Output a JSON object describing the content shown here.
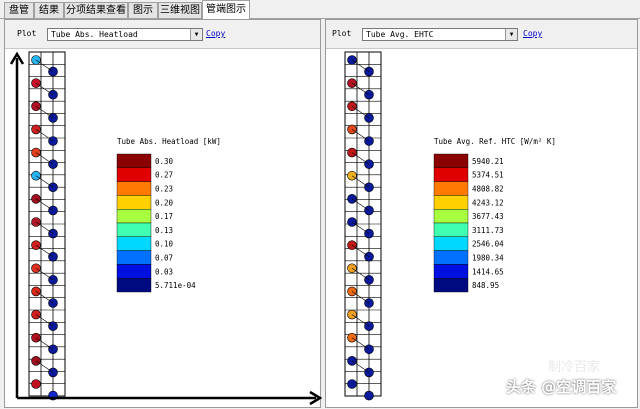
{
  "tabs": [
    "盘管",
    "结果",
    "分项结果查看",
    "图示",
    "三维视图",
    "管端图示"
  ],
  "active_tab": 5,
  "left": {
    "plot_label": "Plot",
    "select_value": "Tube Abs. Heatload",
    "copy_label": "Copy",
    "legend_title": "Tube Abs. Heatload [kW]",
    "legend_values": [
      "0.30",
      "0.27",
      "0.23",
      "0.20",
      "0.17",
      "0.13",
      "0.10",
      "0.07",
      "0.03",
      "5.711e-04"
    ],
    "tube_colors_col1": [
      "#28b4f0",
      "#c8102a",
      "#b31028",
      "#d02020",
      "#e04020",
      "#28b4f0",
      "#a01020",
      "#b01828",
      "#d02020",
      "#e03020",
      "#d82818",
      "#d02020",
      "#b01020",
      "#a01020",
      "#c01020"
    ],
    "tube_colors_col2": [
      "#0a1a9a",
      "#0a1a9a",
      "#0a1a9a",
      "#0a1a9a",
      "#0a1a9a",
      "#0a1a9a",
      "#0a1a9a",
      "#0a1a9a",
      "#0a1a9a",
      "#0a1a9a",
      "#0a1a9a",
      "#0a1a9a",
      "#0a1a9a",
      "#0a1a9a",
      "#1428d0"
    ]
  },
  "right": {
    "plot_label": "Plot",
    "select_value": "Tube Avg. EHTC",
    "copy_label": "Copy",
    "legend_title": "Tube Avg. Ref. HTC [W/m² K]",
    "legend_values": [
      "5940.21",
      "5374.51",
      "4808.82",
      "4243.12",
      "3677.43",
      "3111.73",
      "2546.04",
      "1980.34",
      "1414.65",
      "848.95"
    ],
    "tube_colors_col1": [
      "#0a1a9a",
      "#b01020",
      "#c01818",
      "#e04818",
      "#c01818",
      "#f0b020",
      "#0a1a9a",
      "#0a1a9a",
      "#c01818",
      "#f0a020",
      "#f06a10",
      "#f0a020",
      "#f06a10",
      "#0a1a9a",
      "#0a1a9a"
    ],
    "tube_colors_col2": [
      "#0a1a9a",
      "#0a1a9a",
      "#0a1a9a",
      "#0a1a9a",
      "#0a1a9a",
      "#0a1a9a",
      "#0a1a9a",
      "#0a1a9a",
      "#0a1a9a",
      "#0a1a9a",
      "#0a1a9a",
      "#0a1a9a",
      "#0a1a9a",
      "#0a1a9a",
      "#0a1a9a"
    ]
  },
  "legend_colors": [
    "#8b0000",
    "#e00000",
    "#ff7a00",
    "#ffd000",
    "#a8ff40",
    "#40ffb0",
    "#00d8ff",
    "#0070ff",
    "#0010e0",
    "#000a80"
  ],
  "watermark_text": "头条 @空调百家",
  "watermark_logo_text": "制冷百家"
}
